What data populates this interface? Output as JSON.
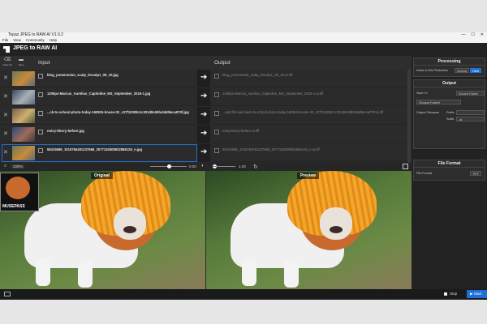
{
  "window": {
    "title": "Topaz JPEG to RAW AI V1.0.2",
    "controls": [
      "—",
      "☐",
      "✕"
    ]
  },
  "menu": [
    "File",
    "View",
    "Community",
    "Help"
  ],
  "app": {
    "name": "JPEG to RAW AI"
  },
  "toolbar": {
    "clear_all": "Clear All",
    "save": "Save"
  },
  "columns": {
    "input": "Input",
    "output": "Output"
  },
  "files": [
    {
      "input": "blog_pomeranian_scalp_Dscalp1_08_10.jpg",
      "output": "blog_pomeranian_scalp_Dscalp1_08_10-ai.tiff"
    },
    {
      "input": "1206px-Marcus_Aurelius_Capitoline_MS_September_2015-1.jpg",
      "output": "1206px-Marcus_Aurelius_Capitoline_MS_September_2015-1-ai.tiff"
    },
    {
      "input": "...ck-to-school-photo-today-160815-house-02_c37f10308c1c301d8c59bcb8d9eca870f.jpg",
      "output": "...porchlit-epic-back-to-school-photo-today-160815-house-02_c37f10308c1c301d8c59bcb8d9eca870f-ai.tiff"
    },
    {
      "input": "noisy-blurry-before.jpg",
      "output": "noisy-blurry-before-ai.tiff"
    },
    {
      "input": "58415586_1015784491237686_3077152508932886126_n.jpg",
      "output": "58415586_1015784491237686_3077152508932886126_n-ai.tiff"
    }
  ],
  "zoombar": {
    "zoom": "100%",
    "left_value": "0.00",
    "right_value": "1.00"
  },
  "views": {
    "original": "Original",
    "preview": "Preview"
  },
  "mini_watermark": "MUSEPASS",
  "processing": {
    "header": "Processing",
    "noise_label": "Noise & Blur Reduction",
    "normal": "Normal",
    "high": "High"
  },
  "output": {
    "header": "Output",
    "save_to_label": "Save To",
    "save_to_value": "Source Folder",
    "source_folder": "[Source Folder]",
    "output_filename_label": "Output Filename",
    "prefix_label": "Prefix",
    "suffix_label": "Suffix",
    "suffix_value": "-ai"
  },
  "file_format": {
    "header": "File Format",
    "label": "File Format",
    "value": "TIFF"
  },
  "bottom": {
    "stop": "Stop",
    "start": "Start"
  },
  "colors": {
    "accent": "#1e6fd6",
    "panel": "#2d2d2d",
    "bg": "#2b2b2b"
  }
}
